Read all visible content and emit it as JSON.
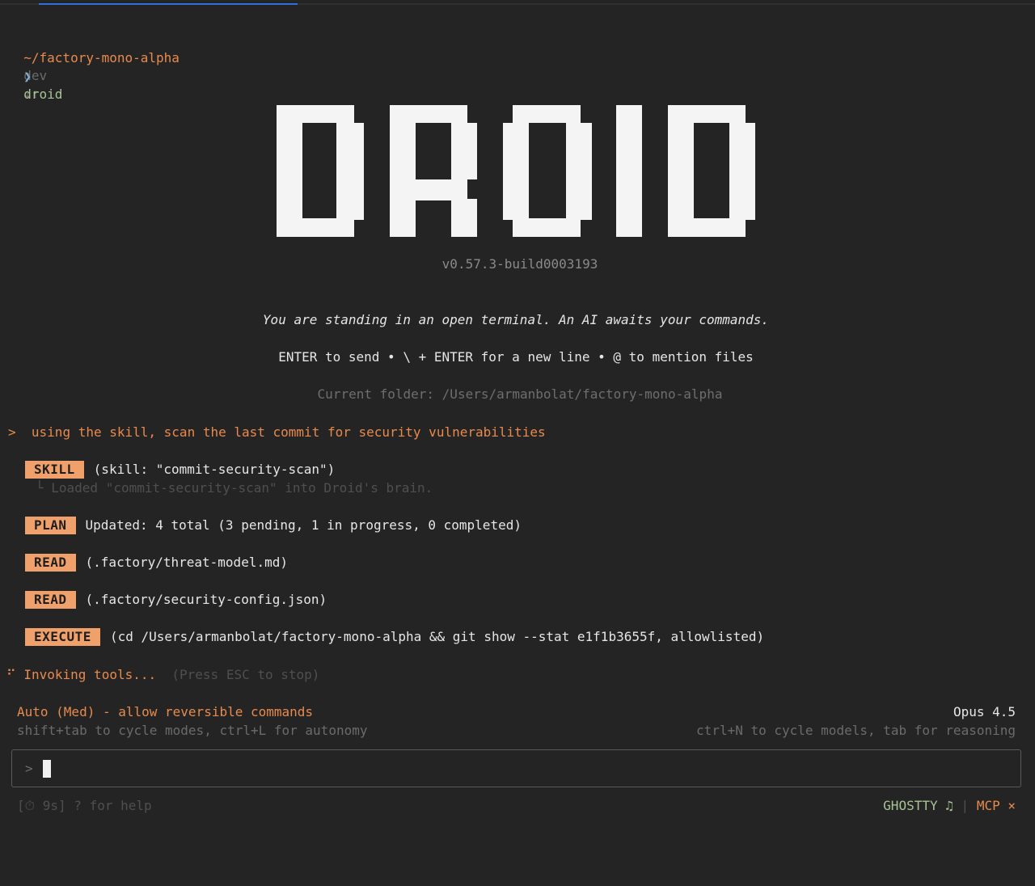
{
  "header": {
    "path": "~/factory-mono-alpha",
    "branch": "dev",
    "git_icon": "git-status-icon",
    "command_prompt": "❯",
    "command": "droid"
  },
  "banner": {
    "logo_text": "DROID",
    "version": "v0.57.3-build0003193",
    "tagline": "You are standing in an open terminal. An AI awaits your commands.",
    "hints": "ENTER to send • \\ + ENTER for a new line • @ to mention files",
    "current_folder": "Current folder: /Users/armanbolat/factory-mono-alpha"
  },
  "user_message": {
    "prompt": ">",
    "text": "using the skill, scan the last commit for security vulnerabilities"
  },
  "actions": [
    {
      "tag": "SKILL",
      "text": "(skill: \"commit-security-scan\")",
      "sub": "└ Loaded \"commit-security-scan\" into Droid's brain."
    },
    {
      "tag": "PLAN",
      "text": "Updated: 4 total (3 pending, 1 in progress, 0 completed)"
    },
    {
      "tag": "READ",
      "text": "(.factory/threat-model.md)"
    },
    {
      "tag": "READ",
      "text": "(.factory/security-config.json)"
    },
    {
      "tag": "EXECUTE",
      "text": "(cd /Users/armanbolat/factory-mono-alpha && git show --stat e1f1b3655f, allowlisted)"
    }
  ],
  "status": {
    "spinner": "⠋",
    "label": "Invoking tools...",
    "hint": "(Press ESC to stop)"
  },
  "mode": {
    "label": "Auto (Med) - allow reversible commands",
    "hint": "shift+tab to cycle modes, ctrl+L for autonomy",
    "model": "Opus 4.5",
    "model_hint": "ctrl+N to cycle models, tab for reasoning"
  },
  "input": {
    "prompt": ">",
    "value": ""
  },
  "footer": {
    "timer": "[⏱ 9s]",
    "help": "? for help",
    "terminal": "GHOSTTY",
    "separator": "|",
    "mcp": "MCP",
    "mcp_status": "×"
  },
  "colors": {
    "background": "#242424",
    "accent": "#e88a4d",
    "tag_bg": "#f0a06a",
    "progress": "#2f6fd8"
  }
}
